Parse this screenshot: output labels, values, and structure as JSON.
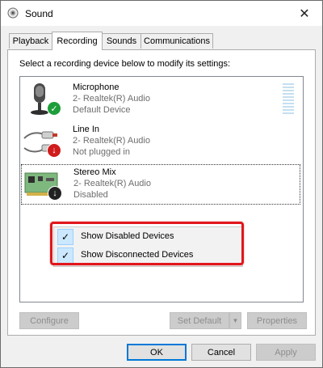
{
  "window": {
    "title": "Sound",
    "close_glyph": "✕"
  },
  "tabs": [
    {
      "label": "Playback",
      "active": false
    },
    {
      "label": "Recording",
      "active": true
    },
    {
      "label": "Sounds",
      "active": false
    },
    {
      "label": "Communications",
      "active": false
    }
  ],
  "panel": {
    "instruction": "Select a recording device below to modify its settings:"
  },
  "devices": [
    {
      "name": "Microphone",
      "driver": "2- Realtek(R) Audio",
      "status": "Default Device",
      "badge": "green-check-icon",
      "badge_color": "#1e9e3a"
    },
    {
      "name": "Line In",
      "driver": "2- Realtek(R) Audio",
      "status": "Not plugged in",
      "badge": "red-down-arrow-icon",
      "badge_color": "#d01c1c"
    },
    {
      "name": "Stereo Mix",
      "driver": "2- Realtek(R) Audio",
      "status": "Disabled",
      "badge": "black-down-arrow-icon",
      "badge_color": "#222222"
    }
  ],
  "context_menu": {
    "items": [
      {
        "label": "Show Disabled Devices",
        "checked": true
      },
      {
        "label": "Show Disconnected Devices",
        "checked": true
      }
    ],
    "check_glyph": "✓"
  },
  "panel_buttons": {
    "configure_label": "Configure",
    "set_default_label": "Set Default",
    "properties_label": "Properties"
  },
  "dialog_buttons": {
    "ok_label": "OK",
    "cancel_label": "Cancel",
    "apply_label": "Apply"
  },
  "colors": {
    "highlight_border": "#e1161c",
    "selection_bg": "#cce8ff",
    "level_meter": "#c5dff0"
  }
}
